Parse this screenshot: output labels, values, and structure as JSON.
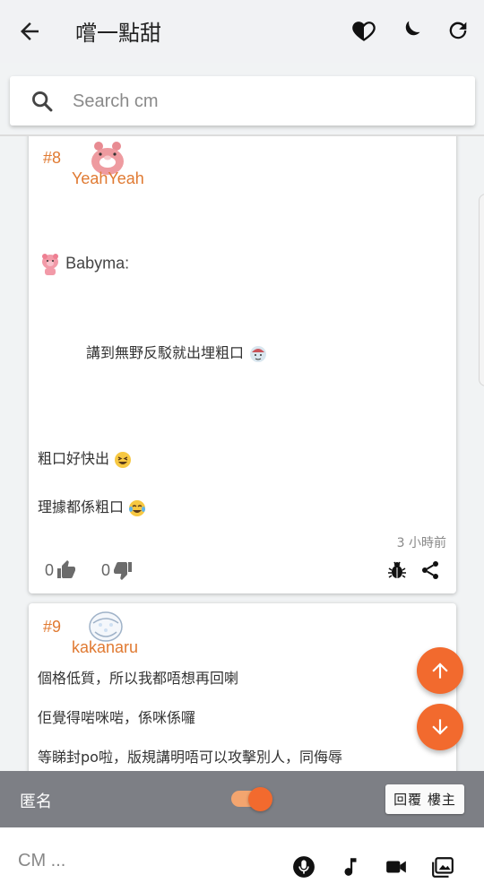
{
  "header": {
    "title": "嚐一點甜",
    "icons": [
      "back-arrow-icon",
      "heart-half-icon",
      "moon-icon",
      "refresh-icon"
    ]
  },
  "search": {
    "placeholder": "Search cm"
  },
  "posts": [
    {
      "floor": "#8",
      "username": "YeahYeah",
      "avatar": "pink-donut-bear",
      "quote_author": "Babyma:",
      "quote_text": "講到無野反駁就出埋粗口",
      "line1": "粗口好快出",
      "line2": "理據都係粗口",
      "timestamp": "3 小時前",
      "likes": "0",
      "dislikes": "0"
    },
    {
      "floor": "#9",
      "username": "kakanaru",
      "avatar": "diaper-bear",
      "line1": "個格低質，所以我都唔想再回喇",
      "line2": "佢覺得啱咪啱，係咪係囉",
      "line3": "等睇封po啦，版規講明唔可以攻擊別人，同侮辱"
    }
  ],
  "anon_bar": {
    "label": "匿名",
    "toggle_on": true,
    "reply_op_label": "回覆 樓主"
  },
  "composer": {
    "placeholder": "CM ...",
    "icons": [
      "microphone-icon",
      "music-note-icon",
      "video-camera-icon",
      "image-gallery-icon"
    ]
  },
  "colors": {
    "accent": "#f26a2e",
    "username": "#e07a32",
    "anon_bar": "#7d7f85"
  }
}
